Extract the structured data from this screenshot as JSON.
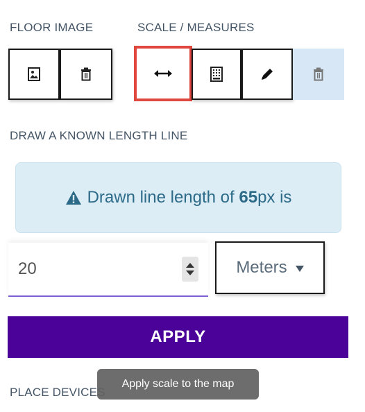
{
  "sections": {
    "floor_image": "FLOOR IMAGE",
    "scale_measures": "SCALE / MEASURES",
    "draw_line": "DRAW A KNOWN LENGTH LINE",
    "place_devices": "PLACE DEVICES"
  },
  "toolbar": {
    "floor_image_buttons": [
      {
        "icon": "image-icon"
      },
      {
        "icon": "trash-icon"
      }
    ],
    "scale_buttons": [
      {
        "icon": "horizontal-arrows-icon",
        "state": "active"
      },
      {
        "icon": "calculator-icon"
      },
      {
        "icon": "pencil-icon"
      },
      {
        "icon": "trash-icon",
        "state": "disabled"
      }
    ]
  },
  "alert": {
    "prefix": "Drawn line length of ",
    "value": "65",
    "suffix": "px is"
  },
  "length_input": {
    "value": "20"
  },
  "unit_select": {
    "selected": "Meters"
  },
  "apply_button": {
    "label": "APPLY"
  },
  "tooltip": {
    "text": "Apply scale to the map"
  },
  "colors": {
    "accent": "#4a0299",
    "active_border": "#e0473f",
    "alert_bg": "#dcedf6",
    "alert_text": "#2c6a88",
    "input_underline": "#7b5ed4",
    "disabled_bg": "#d7e7f6"
  }
}
